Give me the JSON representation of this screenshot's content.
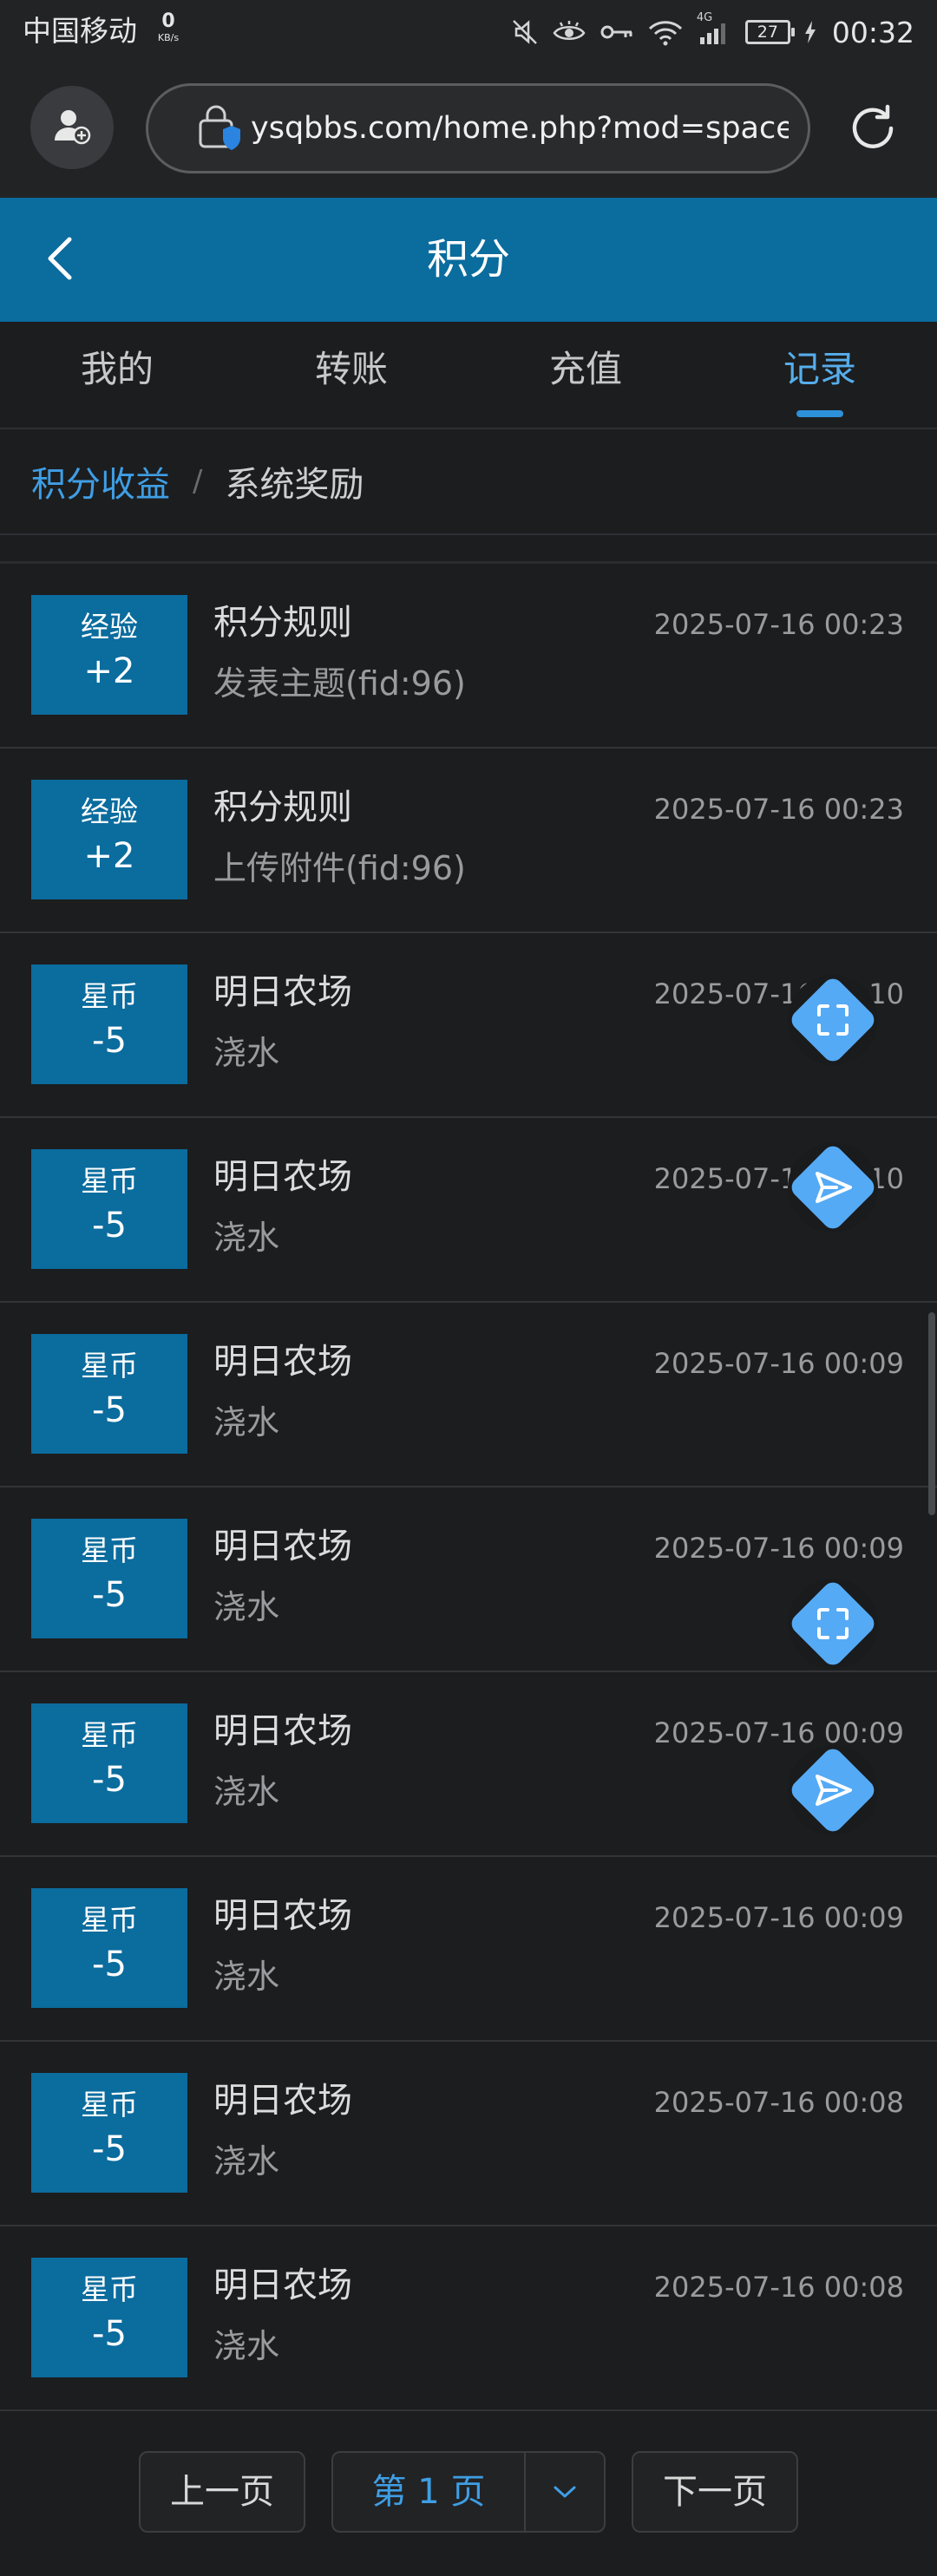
{
  "status_bar": {
    "carrier": "中国移动",
    "net_speed": "0",
    "net_unit": "KB/s",
    "network": "4G",
    "battery": "27",
    "time": "00:32"
  },
  "browser": {
    "url": "ysqbbs.com/home.php?mod=spacecp"
  },
  "header": {
    "title": "积分"
  },
  "tabs": [
    {
      "label": "我的"
    },
    {
      "label": "转账"
    },
    {
      "label": "充值"
    },
    {
      "label": "记录"
    }
  ],
  "breadcrumb": {
    "parent": "积分收益",
    "separator": "/",
    "current": "系统奖励"
  },
  "records": [
    {
      "type": "经验",
      "amount": "+2",
      "title": "积分规则",
      "desc": "发表主题(fid:96)",
      "time": "2025-07-16 00:23"
    },
    {
      "type": "经验",
      "amount": "+2",
      "title": "积分规则",
      "desc": "上传附件(fid:96)",
      "time": "2025-07-16 00:23"
    },
    {
      "type": "星币",
      "amount": "-5",
      "title": "明日农场",
      "desc": "浇水",
      "time": "2025-07-16 00:10"
    },
    {
      "type": "星币",
      "amount": "-5",
      "title": "明日农场",
      "desc": "浇水",
      "time": "2025-07-16 00:10"
    },
    {
      "type": "星币",
      "amount": "-5",
      "title": "明日农场",
      "desc": "浇水",
      "time": "2025-07-16 00:09"
    },
    {
      "type": "星币",
      "amount": "-5",
      "title": "明日农场",
      "desc": "浇水",
      "time": "2025-07-16 00:09"
    },
    {
      "type": "星币",
      "amount": "-5",
      "title": "明日农场",
      "desc": "浇水",
      "time": "2025-07-16 00:09"
    },
    {
      "type": "星币",
      "amount": "-5",
      "title": "明日农场",
      "desc": "浇水",
      "time": "2025-07-16 00:09"
    },
    {
      "type": "星币",
      "amount": "-5",
      "title": "明日农场",
      "desc": "浇水",
      "time": "2025-07-16 00:08"
    },
    {
      "type": "星币",
      "amount": "-5",
      "title": "明日农场",
      "desc": "浇水",
      "time": "2025-07-16 00:08"
    }
  ],
  "pagination": {
    "prev_label": "上一页",
    "current_label": "第 1 页",
    "next_label": "下一页"
  },
  "colors": {
    "accent": "#0b6c9e",
    "link": "#3f9ee4",
    "fab": "#55aaf5",
    "background": "#1c1d1f"
  }
}
